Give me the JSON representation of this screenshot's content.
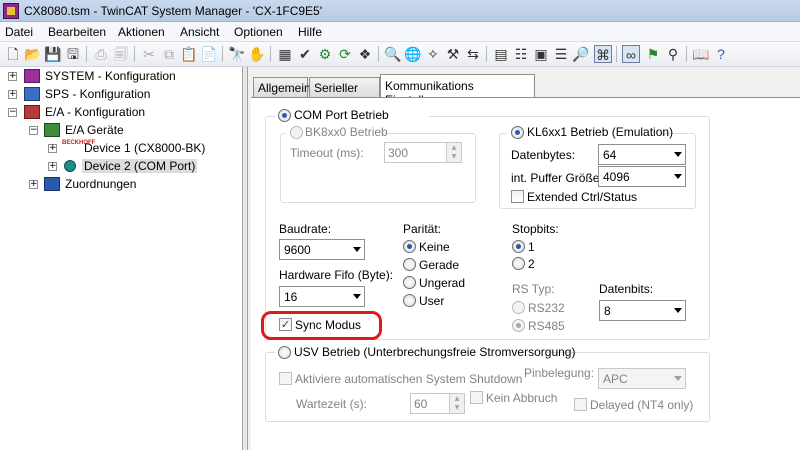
{
  "window": {
    "title": "CX8080.tsm - TwinCAT System Manager - 'CX-1FC9E5'"
  },
  "menu": [
    "Datei",
    "Bearbeiten",
    "Aktionen",
    "Ansicht",
    "Optionen",
    "Hilfe"
  ],
  "tree": {
    "system": "SYSTEM - Konfiguration",
    "sps": "SPS - Konfiguration",
    "ea": "E/A - Konfiguration",
    "ea_geraete": "E/A Geräte",
    "device1": "Device 1 (CX8000-BK)",
    "device2": "Device 2 (COM Port)",
    "zuordnungen": "Zuordnungen",
    "beckhoff_logo": "BECKHOFF"
  },
  "tabs": [
    "Allgemein",
    "Serieller Port",
    "Kommunikations Einstellungen"
  ],
  "com": {
    "com_betrieb": "COM Port Betrieb",
    "bk_betrieb": "BK8xx0 Betrieb",
    "timeout_label": "Timeout (ms):",
    "timeout_value": "300",
    "kl_betrieb": "KL6xx1 Betrieb (Emulation)",
    "datenbytes_label": "Datenbytes:",
    "datenbytes_value": "64",
    "puffer_label": "int. Puffer Größe:",
    "puffer_value": "4096",
    "extended_label": "Extended Ctrl/Status",
    "baudrate_label": "Baudrate:",
    "baudrate_value": "9600",
    "fifo_label": "Hardware Fifo (Byte):",
    "fifo_value": "16",
    "sync_label": "Sync Modus",
    "paritaet_label": "Parität:",
    "paritaet_options": [
      "Keine",
      "Gerade",
      "Ungerad",
      "User"
    ],
    "stopbits_label": "Stopbits:",
    "stopbits_options": [
      "1",
      "2"
    ],
    "rs_label": "RS Typ:",
    "rs_options": [
      "RS232",
      "RS485"
    ],
    "datenbits_label": "Datenbits:",
    "datenbits_value": "8"
  },
  "usv": {
    "betrieb": "USV Betrieb (Unterbrechungsfreie Stromversorgung)",
    "shutdown_label": "Aktiviere automatischen System Shutdown",
    "pinbelegung_label": "Pinbelegung:",
    "pinbelegung_value": "APC",
    "wartezeit_label": "Wartezeit (s):",
    "wartezeit_value": "60",
    "kein_abbruch_label": "Kein Abbruch",
    "delayed_label": "Delayed (NT4 only)"
  }
}
